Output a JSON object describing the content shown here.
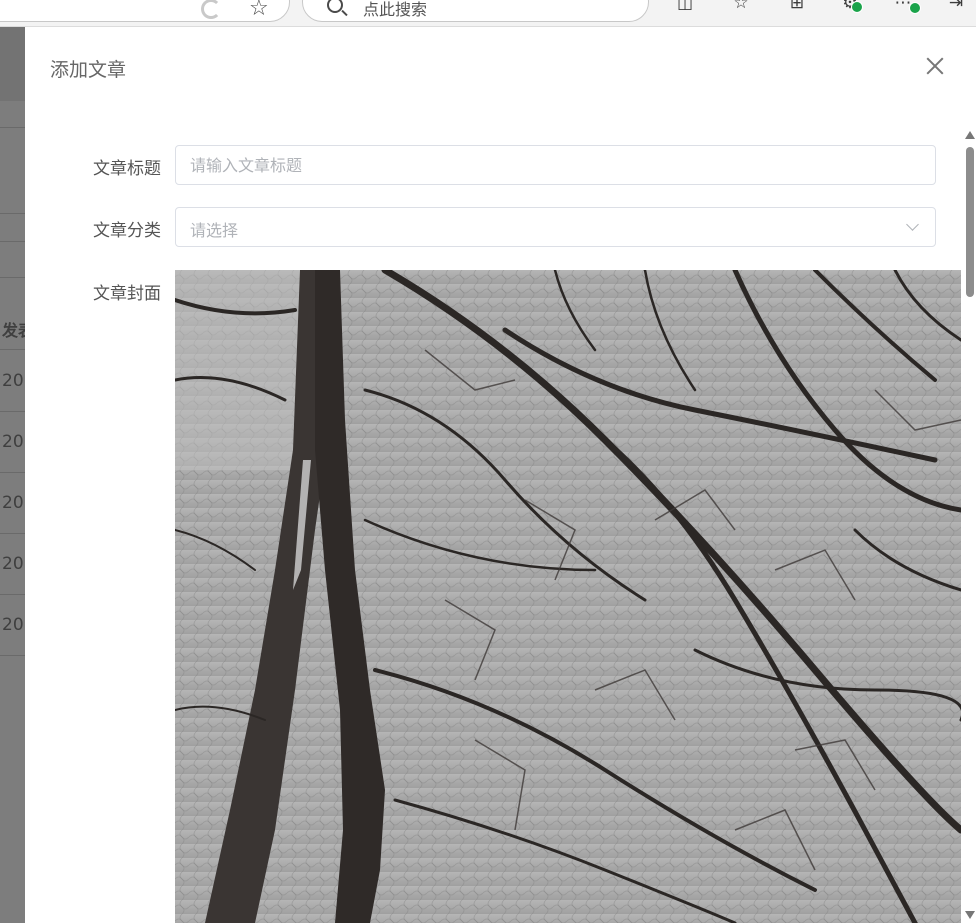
{
  "browser": {
    "search_placeholder": "点此搜索",
    "icons": [
      "edge-icon",
      "favorite-star-icon",
      "search-icon",
      "split-screen-icon",
      "favorites-list-icon",
      "collections-icon",
      "extensions-icon",
      "more-icon",
      "share-icon"
    ]
  },
  "background_table": {
    "header": "发表",
    "rows": [
      "20",
      "20",
      "20",
      "20",
      "20"
    ]
  },
  "drawer": {
    "title": "添加文章",
    "fields": {
      "title": {
        "label": "文章标题",
        "placeholder": "请输入文章标题",
        "value": ""
      },
      "category": {
        "label": "文章分类",
        "placeholder": "请选择"
      },
      "cover": {
        "label": "文章封面"
      }
    }
  }
}
